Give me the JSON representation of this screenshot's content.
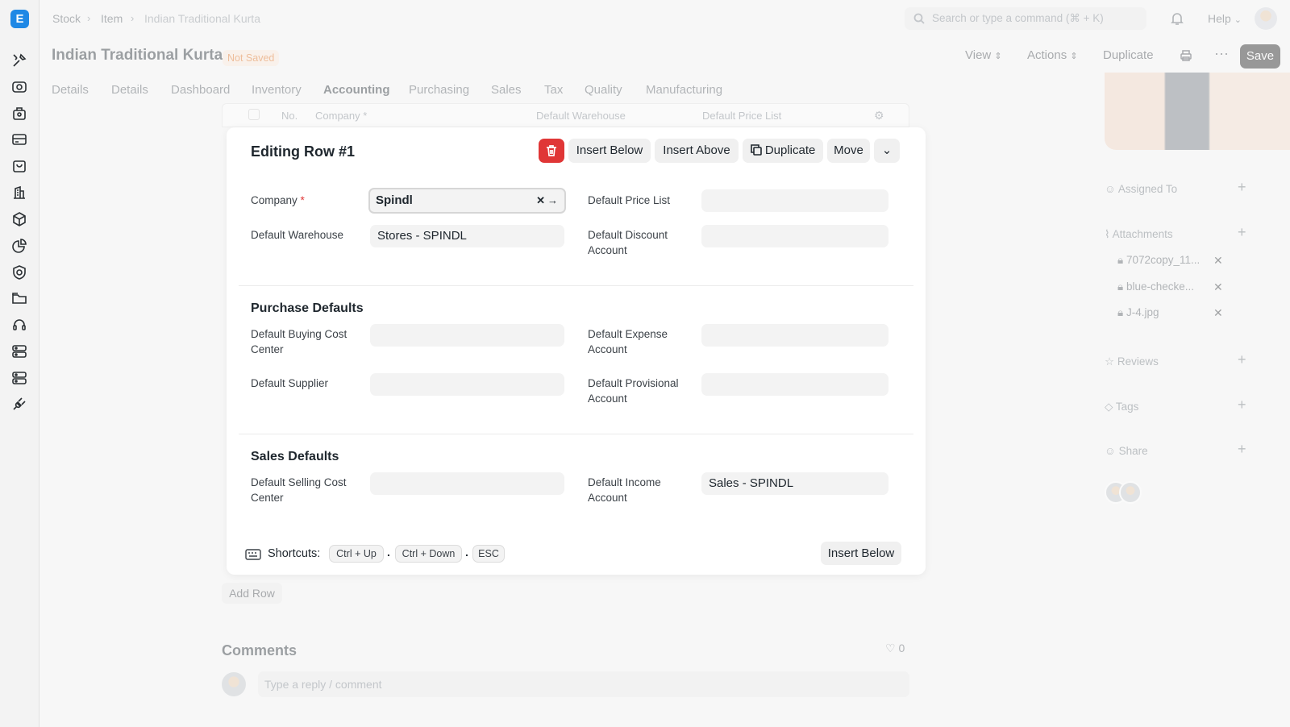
{
  "app": {
    "logo_letter": "E",
    "brand_color": "#1f88e5"
  },
  "sidebar": {
    "icons": [
      "tools-icon",
      "eye-box-icon",
      "briefcase-icon",
      "card-icon",
      "bag-icon",
      "building-icon",
      "cube-icon",
      "pie-chart-icon",
      "shield-icon",
      "folder-icon",
      "headset-icon",
      "server-icon",
      "server-alt-icon",
      "plug-icon"
    ]
  },
  "breadcrumb": {
    "items": [
      "Stock",
      "Item",
      "Indian Traditional Kurta"
    ]
  },
  "search": {
    "placeholder": "Search or type a command (⌘ + K)"
  },
  "header": {
    "help_label": "Help",
    "title": "Indian Traditional Kurta",
    "status": "Not Saved",
    "view_label": "View",
    "actions_label": "Actions",
    "duplicate_label": "Duplicate",
    "save_label": "Save"
  },
  "tabs": [
    "Details",
    "Details",
    "Dashboard",
    "Inventory",
    "Accounting",
    "Purchasing",
    "Sales",
    "Tax",
    "Quality",
    "Manufacturing"
  ],
  "active_tab": "Accounting",
  "grid": {
    "columns": [
      "No.",
      "Company *",
      "Default Warehouse",
      "Default Price List"
    ]
  },
  "right_sidebar": {
    "assigned_to": "Assigned To",
    "attachments_label": "Attachments",
    "attachments": [
      "7072copy_11...",
      "blue-checke...",
      "J-4.jpg"
    ],
    "reviews": "Reviews",
    "tags": "Tags",
    "share": "Share"
  },
  "editor": {
    "title": "Editing Row #1",
    "insert_below": "Insert Below",
    "insert_above": "Insert Above",
    "duplicate": "Duplicate",
    "move": "Move",
    "fields": {
      "company_label": "Company",
      "company_value": "Spindl",
      "price_list_label": "Default Price List",
      "price_list_value": "",
      "warehouse_label": "Default Warehouse",
      "warehouse_value": "Stores - SPINDL",
      "discount_label": "Default Discount Account",
      "discount_value": ""
    },
    "purchase": {
      "title": "Purchase Defaults",
      "buying_cc_label": "Default Buying Cost Center",
      "expense_label": "Default Expense Account",
      "supplier_label": "Default Supplier",
      "provisional_label": "Default Provisional Account"
    },
    "sales": {
      "title": "Sales Defaults",
      "selling_cc_label": "Default Selling Cost Center",
      "income_label": "Default Income Account",
      "income_value": "Sales - SPINDL"
    },
    "shortcuts_label": "Shortcuts:",
    "shortcut_keys": [
      "Ctrl + Up",
      "Ctrl + Down",
      "ESC"
    ],
    "insert_below_footer": "Insert Below"
  },
  "add_row": "Add Row",
  "comments": {
    "title": "Comments",
    "likes": "0",
    "placeholder": "Type a reply / comment"
  }
}
